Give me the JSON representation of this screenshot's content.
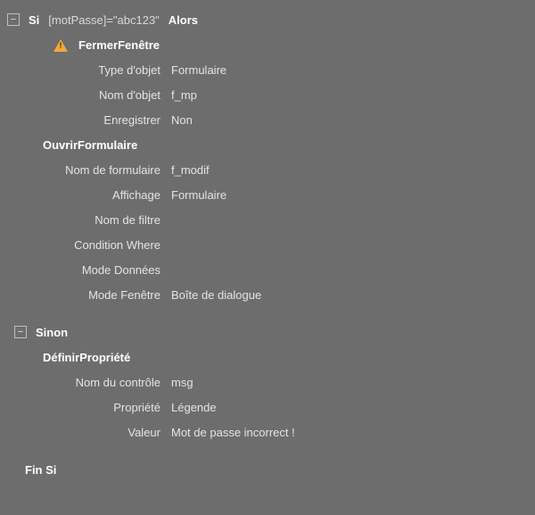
{
  "si": {
    "keyword": "Si",
    "expression": "[motPasse]=\"abc123\"",
    "then": "Alors"
  },
  "fermer": {
    "name": "FermerFenêtre",
    "params": [
      {
        "label": "Type d'objet",
        "value": "Formulaire"
      },
      {
        "label": "Nom d'objet",
        "value": "f_mp"
      },
      {
        "label": "Enregistrer",
        "value": "Non"
      }
    ]
  },
  "ouvrir": {
    "name": "OuvrirFormulaire",
    "params": [
      {
        "label": "Nom de formulaire",
        "value": "f_modif"
      },
      {
        "label": "Affichage",
        "value": "Formulaire"
      },
      {
        "label": "Nom de filtre",
        "value": ""
      },
      {
        "label": "Condition Where",
        "value": ""
      },
      {
        "label": "Mode Données",
        "value": ""
      },
      {
        "label": "Mode Fenêtre",
        "value": "Boîte de dialogue"
      }
    ]
  },
  "sinon": {
    "keyword": "Sinon"
  },
  "definir": {
    "name": "DéfinirPropriété",
    "params": [
      {
        "label": "Nom du contrôle",
        "value": "msg"
      },
      {
        "label": "Propriété",
        "value": "Légende"
      },
      {
        "label": "Valeur",
        "value": "Mot de passe incorrect !"
      }
    ]
  },
  "fin": {
    "keyword": "Fin Si"
  }
}
